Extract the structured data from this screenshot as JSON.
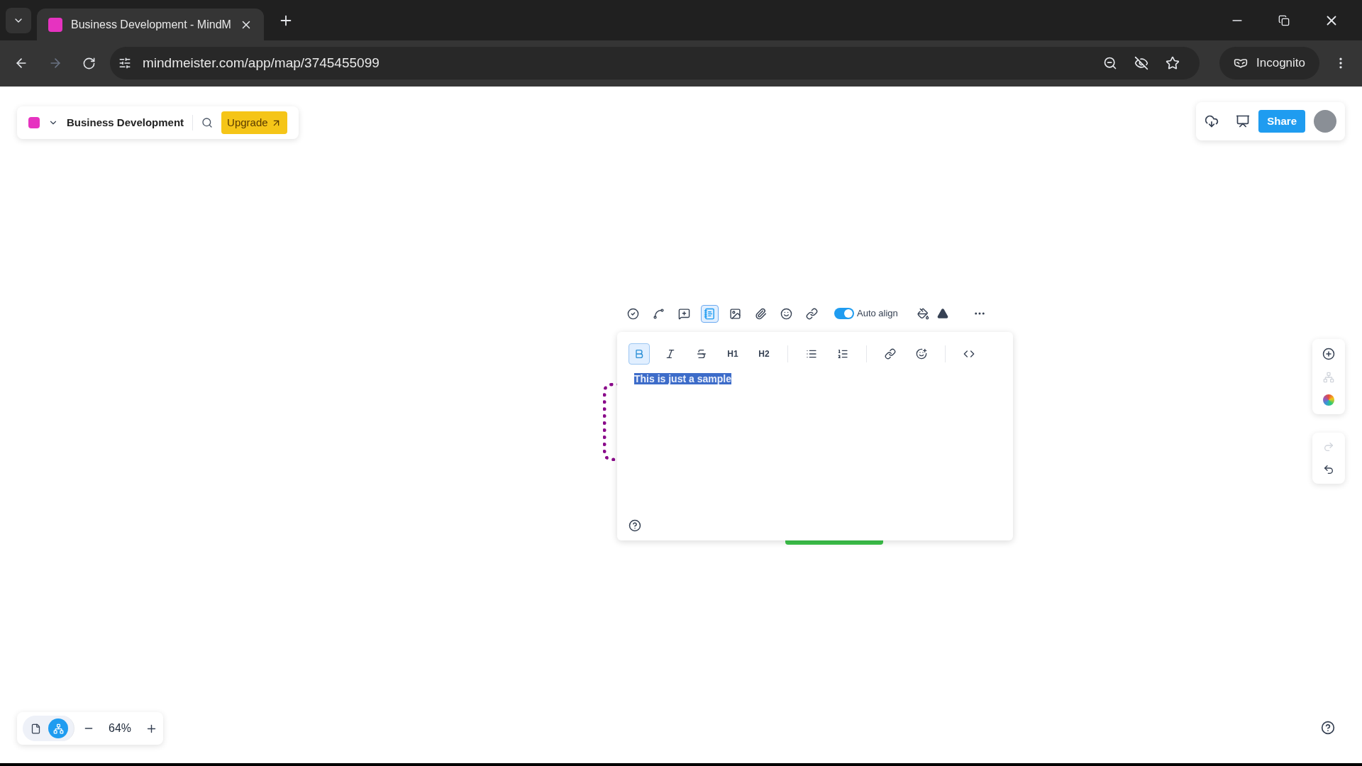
{
  "browser": {
    "tab_title": "Business Development - MindM",
    "url": "mindmeister.com/app/map/3745455099",
    "profile": "Incognito"
  },
  "header": {
    "map_title": "Business Development",
    "upgrade": "Upgrade",
    "share": "Share"
  },
  "topic_toolbar": {
    "tools": [
      {
        "selected": false
      },
      {
        "selected": false
      },
      {
        "selected": false
      },
      {
        "selected": true
      },
      {
        "selected": false
      },
      {
        "selected": false
      },
      {
        "selected": false
      },
      {
        "selected": false
      }
    ],
    "auto_align": {
      "label": "Auto align",
      "on": true
    }
  },
  "note_editor": {
    "format_buttons": [
      {
        "kind": "icon",
        "selected": true
      },
      {
        "kind": "icon",
        "selected": false
      },
      {
        "kind": "icon",
        "selected": false
      },
      {
        "kind": "text",
        "label": "H1",
        "selected": false
      },
      {
        "kind": "text",
        "label": "H2",
        "selected": false
      },
      {
        "kind": "icon",
        "selected": false
      },
      {
        "kind": "icon",
        "selected": false
      },
      {
        "kind": "icon",
        "selected": false
      },
      {
        "kind": "icon",
        "selected": false
      },
      {
        "kind": "icon",
        "selected": false
      }
    ],
    "text": "This is just a sample",
    "text_selected": true
  },
  "view_modes": [
    {
      "selected": false
    },
    {
      "selected": true
    }
  ],
  "zoom": "64%"
}
